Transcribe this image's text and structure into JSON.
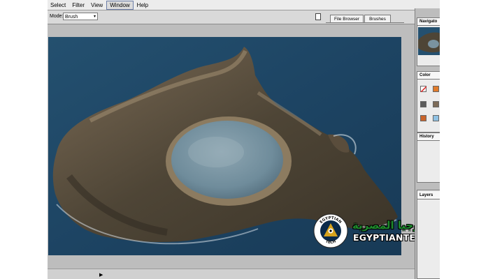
{
  "menubar": {
    "items": [
      {
        "label": "Select"
      },
      {
        "label": "Filter"
      },
      {
        "label": "View"
      },
      {
        "label": "Window",
        "active": true
      },
      {
        "label": "Help"
      }
    ]
  },
  "options_bar": {
    "mode_label": "Mode:",
    "mode_value": "Brush",
    "palette_tabs": [
      "File Browser",
      "Brushes"
    ]
  },
  "panels": {
    "navigator": {
      "label": "Navigato"
    },
    "color": {
      "label": "Color"
    },
    "history": {
      "label": "History"
    },
    "layers": {
      "label": "Layers"
    }
  },
  "colors": {
    "watermark_green": "#1e8a2c",
    "active_menu_border": "#6c7ea8"
  },
  "watermark": {
    "arabic_text": "التكنولوجيا المصرية",
    "latin_text": "EGYPTIANTECH.ORG",
    "logo_text": "EGYPTIAN TECH"
  }
}
